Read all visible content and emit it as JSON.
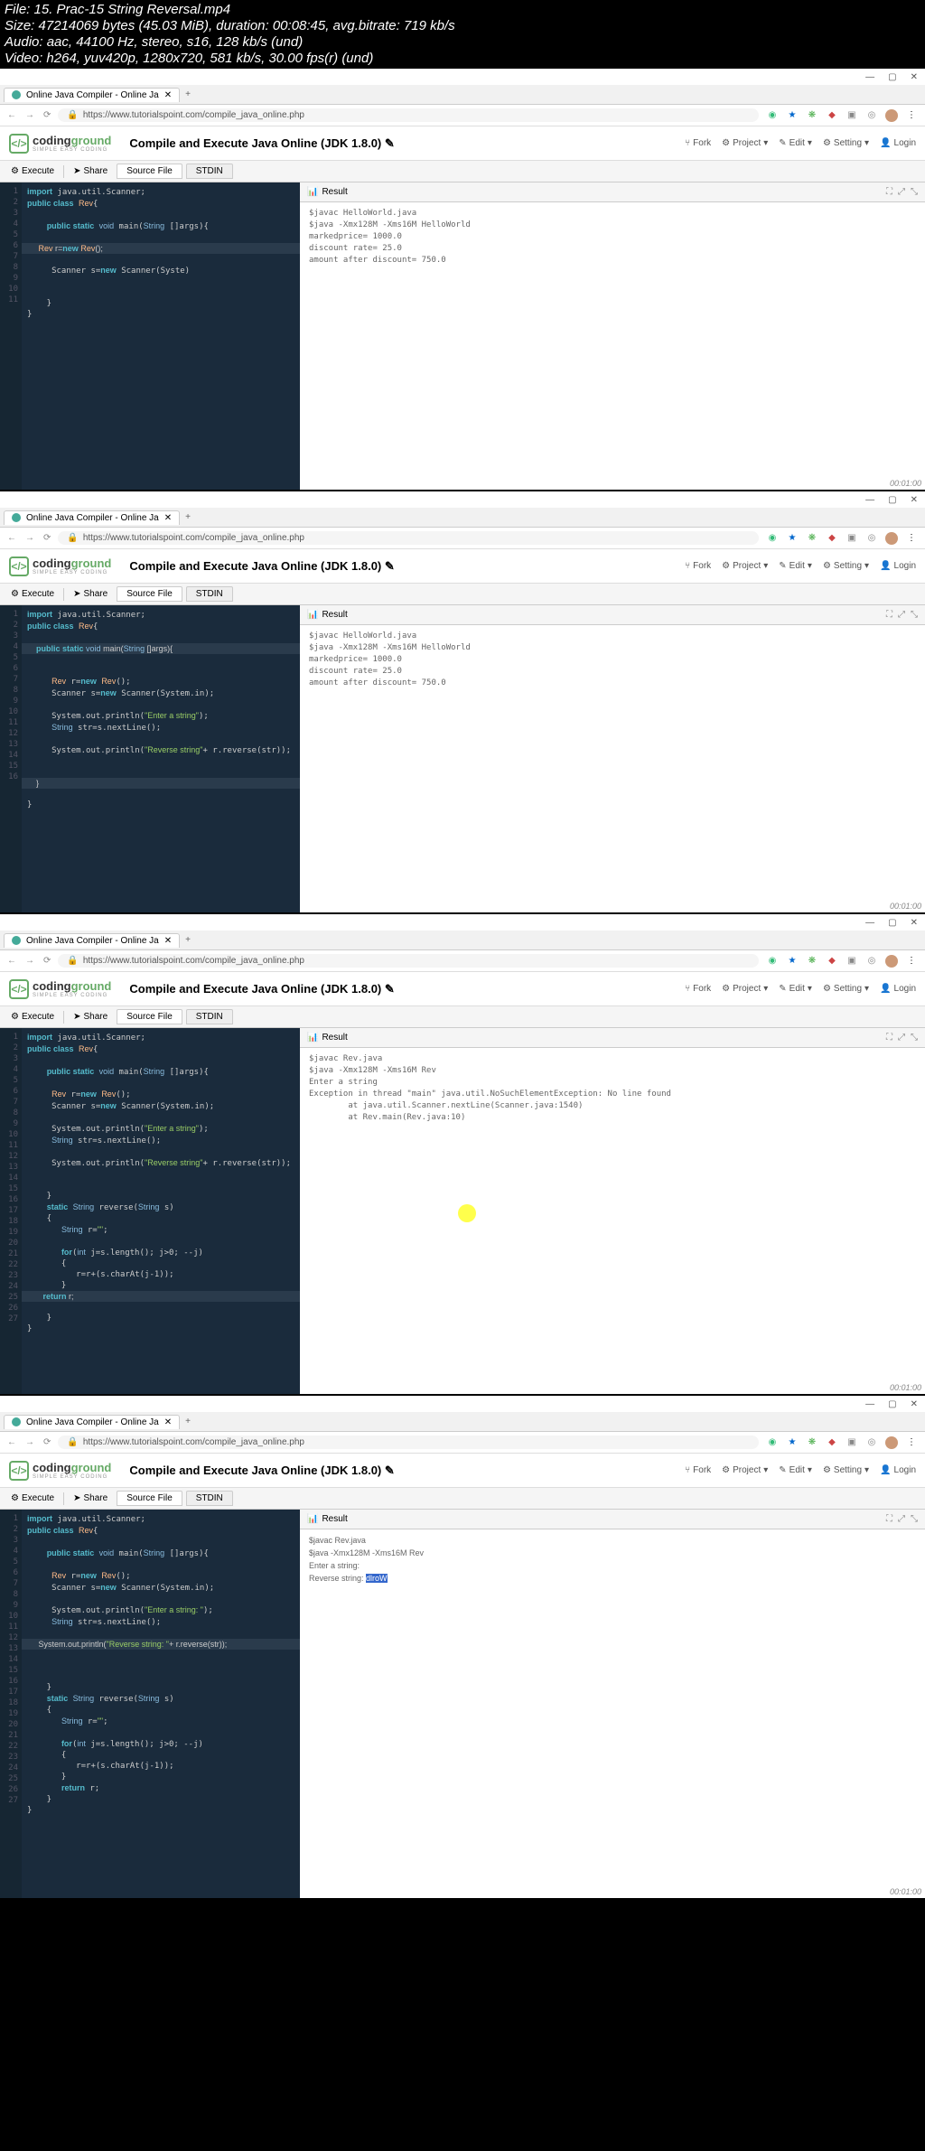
{
  "overlay": {
    "file": "File: 15. Prac-15 String Reversal.mp4",
    "size": "Size: 47214069 bytes (45.03 MiB), duration: 00:08:45, avg.bitrate: 719 kb/s",
    "audio": "Audio: aac, 44100 Hz, stereo, s16, 128 kb/s (und)",
    "video": "Video: h264, yuv420p, 1280x720, 581 kb/s, 30.00 fps(r) (und)"
  },
  "browser": {
    "tab_title": "Online Java Compiler - Online Ja",
    "url": "https://www.tutorialspoint.com/compile_java_online.php"
  },
  "header": {
    "logo_main": "coding",
    "logo_accent": "ground",
    "logo_sub": "SIMPLE EASY CODING",
    "title": "Compile and Execute Java Online (JDK 1.8.0)",
    "fork": "Fork",
    "project": "Project",
    "edit": "Edit",
    "setting": "Setting",
    "login": "Login"
  },
  "toolbar": {
    "execute": "Execute",
    "share": "Share",
    "source": "Source File",
    "stdin": "STDIN",
    "result": "Result"
  },
  "frame1": {
    "lines": [
      "1",
      "2",
      "3",
      "4",
      "5",
      "6",
      "7",
      "8",
      "9",
      "10",
      "11"
    ],
    "output": "$javac HelloWorld.java\n$java -Xmx128M -Xms16M HelloWorld\nmarkedprice= 1000.0\ndiscount rate= 25.0\namount after discount= 750.0"
  },
  "frame2": {
    "lines": [
      "1",
      "2",
      "3",
      "4",
      "5",
      "6",
      "7",
      "8",
      "9",
      "10",
      "11",
      "12",
      "13",
      "14",
      "15",
      "16"
    ],
    "output": "$javac HelloWorld.java\n$java -Xmx128M -Xms16M HelloWorld\nmarkedprice= 1000.0\ndiscount rate= 25.0\namount after discount= 750.0"
  },
  "frame3": {
    "lines": [
      "1",
      "2",
      "3",
      "4",
      "5",
      "6",
      "7",
      "8",
      "9",
      "10",
      "11",
      "12",
      "13",
      "14",
      "15",
      "16",
      "17",
      "18",
      "19",
      "20",
      "21",
      "22",
      "23",
      "24",
      "25",
      "26",
      "27"
    ],
    "output": "$javac Rev.java\n$java -Xmx128M -Xms16M Rev\nEnter a string\nException in thread \"main\" java.util.NoSuchElementException: No line found\n        at java.util.Scanner.nextLine(Scanner.java:1540)\n        at Rev.main(Rev.java:10)"
  },
  "frame4": {
    "lines": [
      "1",
      "2",
      "3",
      "4",
      "5",
      "6",
      "7",
      "8",
      "9",
      "10",
      "11",
      "12",
      "13",
      "14",
      "15",
      "16",
      "17",
      "18",
      "19",
      "20",
      "21",
      "22",
      "23",
      "24",
      "25",
      "26",
      "27"
    ],
    "output_pre": "$javac Rev.java\n$java -Xmx128M -Xms16M Rev\nEnter a string:\nReverse string: ",
    "output_sel": "dlroW"
  }
}
